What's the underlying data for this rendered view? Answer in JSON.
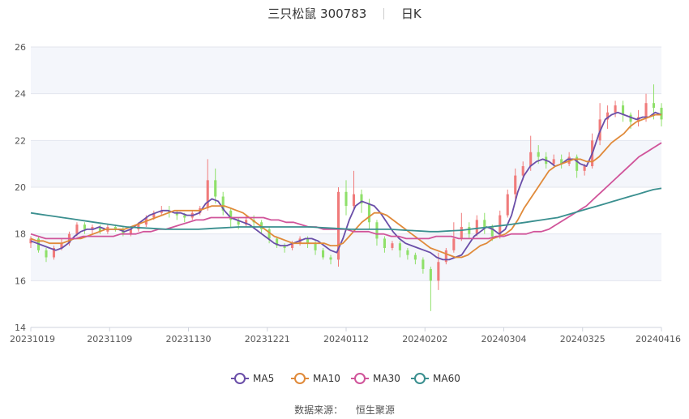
{
  "header": {
    "title": "三只松鼠 300783",
    "period": "日K"
  },
  "source": {
    "label": "数据来源：",
    "value": "恒生聚源"
  },
  "chart_data": {
    "type": "candlestick",
    "ylim": [
      14,
      26
    ],
    "yticks": [
      "14",
      "16",
      "18",
      "20",
      "22",
      "24",
      "26"
    ],
    "xticks": [
      "20231019",
      "20231109",
      "20231130",
      "20231221",
      "20240112",
      "20240202",
      "20240304",
      "20240325",
      "20240416"
    ],
    "num_days": 120,
    "up_color": "#f07b7b",
    "down_color": "#8fe06a",
    "legend_position": "bottom",
    "series": [
      {
        "name": "MA5",
        "color": "#6a4ea8",
        "values": [
          17.7,
          17.6,
          17.5,
          17.4,
          17.3,
          17.4,
          17.6,
          17.9,
          18.1,
          18.2,
          18.2,
          18.3,
          18.2,
          18.2,
          18.2,
          18.1,
          18.2,
          18.4,
          18.6,
          18.8,
          18.9,
          19.0,
          19.0,
          18.9,
          18.9,
          18.8,
          18.8,
          18.9,
          19.3,
          19.5,
          19.4,
          19.0,
          18.7,
          18.6,
          18.5,
          18.4,
          18.2,
          18.0,
          17.8,
          17.6,
          17.5,
          17.5,
          17.6,
          17.7,
          17.8,
          17.8,
          17.7,
          17.5,
          17.3,
          17.2,
          17.8,
          18.6,
          19.2,
          19.4,
          19.3,
          19.2,
          18.9,
          18.5,
          18.1,
          17.8,
          17.6,
          17.5,
          17.4,
          17.3,
          17.2,
          17.0,
          16.9,
          16.9,
          17.0,
          17.1,
          17.5,
          17.9,
          18.1,
          18.3,
          18.2,
          18.0,
          18.2,
          18.8,
          19.8,
          20.5,
          20.9,
          21.1,
          21.2,
          21.1,
          20.9,
          21.0,
          21.2,
          21.2,
          21.0,
          20.9,
          21.5,
          22.3,
          22.9,
          23.1,
          23.2,
          23.1,
          23.0,
          22.9,
          23.0,
          23.0,
          23.2,
          23.1
        ]
      },
      {
        "name": "MA10",
        "color": "#e08a3a",
        "values": [
          17.8,
          17.7,
          17.7,
          17.6,
          17.6,
          17.6,
          17.7,
          17.8,
          17.8,
          17.9,
          18.0,
          18.1,
          18.2,
          18.2,
          18.2,
          18.2,
          18.3,
          18.4,
          18.5,
          18.6,
          18.7,
          18.8,
          18.9,
          19.0,
          19.0,
          19.0,
          19.0,
          19.0,
          19.1,
          19.2,
          19.2,
          19.2,
          19.1,
          19.0,
          18.9,
          18.7,
          18.5,
          18.3,
          18.1,
          17.9,
          17.8,
          17.7,
          17.6,
          17.6,
          17.6,
          17.6,
          17.6,
          17.6,
          17.5,
          17.5,
          17.6,
          17.9,
          18.2,
          18.5,
          18.7,
          18.9,
          18.9,
          18.8,
          18.6,
          18.4,
          18.2,
          18.0,
          17.8,
          17.6,
          17.4,
          17.3,
          17.2,
          17.1,
          17.0,
          17.0,
          17.1,
          17.3,
          17.5,
          17.6,
          17.8,
          17.9,
          18.0,
          18.2,
          18.6,
          19.1,
          19.5,
          19.9,
          20.3,
          20.7,
          20.9,
          21.0,
          21.1,
          21.2,
          21.2,
          21.1,
          21.1,
          21.3,
          21.6,
          21.9,
          22.1,
          22.3,
          22.6,
          22.8,
          22.9,
          23.0,
          23.1,
          23.1
        ]
      },
      {
        "name": "MA30",
        "color": "#d0549a",
        "values": [
          18.0,
          17.9,
          17.8,
          17.8,
          17.8,
          17.8,
          17.8,
          17.9,
          17.9,
          17.9,
          17.9,
          17.9,
          18.0,
          18.0,
          18.0,
          18.1,
          18.1,
          18.2,
          18.2,
          18.3,
          18.4,
          18.5,
          18.6,
          18.6,
          18.7,
          18.7,
          18.7,
          18.7,
          18.7,
          18.7,
          18.7,
          18.7,
          18.6,
          18.6,
          18.5,
          18.5,
          18.4,
          18.3,
          18.3,
          18.2,
          18.2,
          18.2,
          18.2,
          18.1,
          18.1,
          18.1,
          18.0,
          18.0,
          17.9,
          17.9,
          17.8,
          17.8,
          17.8,
          17.8,
          17.9,
          17.9,
          17.9,
          17.8,
          17.8,
          17.8,
          17.8,
          17.8,
          17.9,
          17.9,
          18.0,
          18.0,
          18.0,
          18.1,
          18.1,
          18.2,
          18.4,
          18.6,
          18.8,
          19.0,
          19.2,
          19.5,
          19.8,
          20.1,
          20.4,
          20.7,
          21.0,
          21.3,
          21.5,
          21.7,
          21.9
        ]
      },
      {
        "name": "MA60",
        "color": "#3a8f8f",
        "values": [
          18.9,
          18.85,
          18.8,
          18.75,
          18.7,
          18.65,
          18.6,
          18.55,
          18.5,
          18.45,
          18.4,
          18.35,
          18.3,
          18.28,
          18.26,
          18.24,
          18.22,
          18.2,
          18.2,
          18.2,
          18.2,
          18.2,
          18.22,
          18.24,
          18.26,
          18.28,
          18.3,
          18.3,
          18.3,
          18.3,
          18.3,
          18.3,
          18.3,
          18.3,
          18.3,
          18.3,
          18.28,
          18.26,
          18.24,
          18.22,
          18.2,
          18.2,
          18.2,
          18.2,
          18.2,
          18.2,
          18.18,
          18.16,
          18.14,
          18.12,
          18.1,
          18.1,
          18.12,
          18.14,
          18.16,
          18.2,
          18.24,
          18.28,
          18.32,
          18.36,
          18.4,
          18.45,
          18.5,
          18.55,
          18.6,
          18.65,
          18.7,
          18.8,
          18.9,
          19.0,
          19.1,
          19.2,
          19.3,
          19.4,
          19.5,
          19.6,
          19.7,
          19.8,
          19.9,
          19.95
        ]
      }
    ],
    "candles": [
      [
        17.6,
        17.8,
        17.4,
        17.9
      ],
      [
        17.8,
        17.3,
        17.2,
        17.9
      ],
      [
        17.3,
        17.0,
        16.8,
        17.4
      ],
      [
        17.0,
        17.4,
        16.9,
        17.5
      ],
      [
        17.4,
        17.6,
        17.3,
        17.8
      ],
      [
        17.6,
        18.0,
        17.5,
        18.1
      ],
      [
        18.0,
        18.4,
        17.9,
        18.5
      ],
      [
        18.4,
        18.2,
        18.0,
        18.5
      ],
      [
        18.2,
        18.3,
        18.0,
        18.4
      ],
      [
        18.3,
        18.1,
        18.0,
        18.4
      ],
      [
        18.1,
        18.3,
        18.0,
        18.4
      ],
      [
        18.3,
        18.2,
        18.1,
        18.4
      ],
      [
        18.2,
        18.0,
        17.9,
        18.3
      ],
      [
        18.0,
        18.2,
        17.9,
        18.3
      ],
      [
        18.2,
        18.4,
        18.1,
        18.5
      ],
      [
        18.4,
        18.7,
        18.3,
        18.8
      ],
      [
        18.7,
        18.9,
        18.6,
        19.0
      ],
      [
        18.9,
        19.0,
        18.8,
        19.2
      ],
      [
        19.0,
        18.9,
        18.7,
        19.2
      ],
      [
        18.9,
        18.8,
        18.6,
        19.0
      ],
      [
        18.8,
        18.7,
        18.5,
        18.9
      ],
      [
        18.7,
        18.9,
        18.6,
        19.0
      ],
      [
        18.9,
        19.1,
        18.8,
        19.2
      ],
      [
        19.1,
        20.3,
        19.0,
        21.2
      ],
      [
        20.3,
        19.6,
        19.3,
        20.8
      ],
      [
        19.6,
        19.0,
        18.8,
        19.8
      ],
      [
        19.0,
        18.6,
        18.3,
        19.1
      ],
      [
        18.6,
        18.4,
        18.2,
        18.7
      ],
      [
        18.4,
        18.6,
        18.3,
        18.8
      ],
      [
        18.6,
        18.5,
        18.3,
        18.8
      ],
      [
        18.5,
        18.2,
        18.0,
        18.6
      ],
      [
        18.2,
        17.8,
        17.6,
        18.3
      ],
      [
        17.8,
        17.5,
        17.4,
        17.9
      ],
      [
        17.5,
        17.4,
        17.2,
        17.6
      ],
      [
        17.4,
        17.6,
        17.3,
        17.7
      ],
      [
        17.6,
        17.8,
        17.5,
        17.9
      ],
      [
        17.8,
        17.6,
        17.4,
        17.9
      ],
      [
        17.6,
        17.3,
        17.1,
        17.7
      ],
      [
        17.3,
        17.0,
        16.9,
        17.4
      ],
      [
        17.0,
        16.9,
        16.7,
        17.1
      ],
      [
        16.9,
        19.8,
        16.6,
        20.0
      ],
      [
        19.8,
        19.2,
        18.8,
        20.3
      ],
      [
        19.2,
        19.7,
        19.0,
        20.7
      ],
      [
        19.7,
        19.3,
        18.9,
        19.9
      ],
      [
        19.3,
        18.5,
        18.2,
        19.5
      ],
      [
        18.5,
        17.8,
        17.5,
        18.6
      ],
      [
        17.8,
        17.4,
        17.2,
        17.9
      ],
      [
        17.4,
        17.6,
        17.3,
        17.7
      ],
      [
        17.6,
        17.3,
        17.0,
        17.7
      ],
      [
        17.3,
        17.1,
        16.9,
        17.4
      ],
      [
        17.1,
        16.9,
        16.7,
        17.2
      ],
      [
        16.9,
        16.5,
        16.3,
        17.0
      ],
      [
        16.5,
        16.0,
        14.7,
        16.6
      ],
      [
        16.0,
        16.8,
        15.6,
        17.2
      ],
      [
        16.8,
        17.3,
        16.7,
        17.4
      ],
      [
        17.3,
        17.8,
        17.2,
        18.5
      ],
      [
        17.8,
        18.3,
        17.7,
        18.9
      ],
      [
        18.3,
        18.0,
        17.8,
        18.5
      ],
      [
        18.0,
        18.6,
        17.9,
        18.8
      ],
      [
        18.6,
        18.3,
        18.0,
        18.9
      ],
      [
        18.3,
        17.9,
        17.7,
        18.4
      ],
      [
        17.9,
        18.8,
        17.8,
        19.0
      ],
      [
        18.8,
        19.7,
        18.7,
        19.9
      ],
      [
        19.7,
        20.5,
        19.5,
        20.8
      ],
      [
        20.5,
        20.9,
        20.3,
        21.1
      ],
      [
        20.9,
        21.5,
        20.7,
        22.2
      ],
      [
        21.5,
        21.3,
        21.0,
        21.8
      ],
      [
        21.3,
        21.0,
        20.8,
        21.5
      ],
      [
        21.0,
        21.2,
        20.9,
        21.4
      ],
      [
        21.2,
        21.0,
        20.8,
        21.4
      ],
      [
        21.0,
        21.3,
        20.9,
        21.5
      ],
      [
        21.3,
        20.7,
        20.4,
        21.4
      ],
      [
        20.7,
        20.9,
        20.5,
        21.0
      ],
      [
        20.9,
        22.0,
        20.8,
        22.3
      ],
      [
        22.0,
        22.9,
        21.8,
        23.6
      ],
      [
        22.9,
        23.2,
        22.5,
        23.5
      ],
      [
        23.2,
        23.5,
        23.0,
        23.7
      ],
      [
        23.5,
        23.1,
        22.8,
        23.7
      ],
      [
        23.1,
        22.8,
        22.5,
        23.2
      ],
      [
        22.8,
        23.0,
        22.6,
        23.3
      ],
      [
        23.0,
        23.6,
        22.8,
        24.0
      ],
      [
        23.6,
        23.4,
        22.9,
        24.4
      ],
      [
        23.4,
        22.9,
        22.6,
        23.6
      ]
    ]
  },
  "legend": [
    {
      "label": "MA5"
    },
    {
      "label": "MA10"
    },
    {
      "label": "MA30"
    },
    {
      "label": "MA60"
    }
  ]
}
